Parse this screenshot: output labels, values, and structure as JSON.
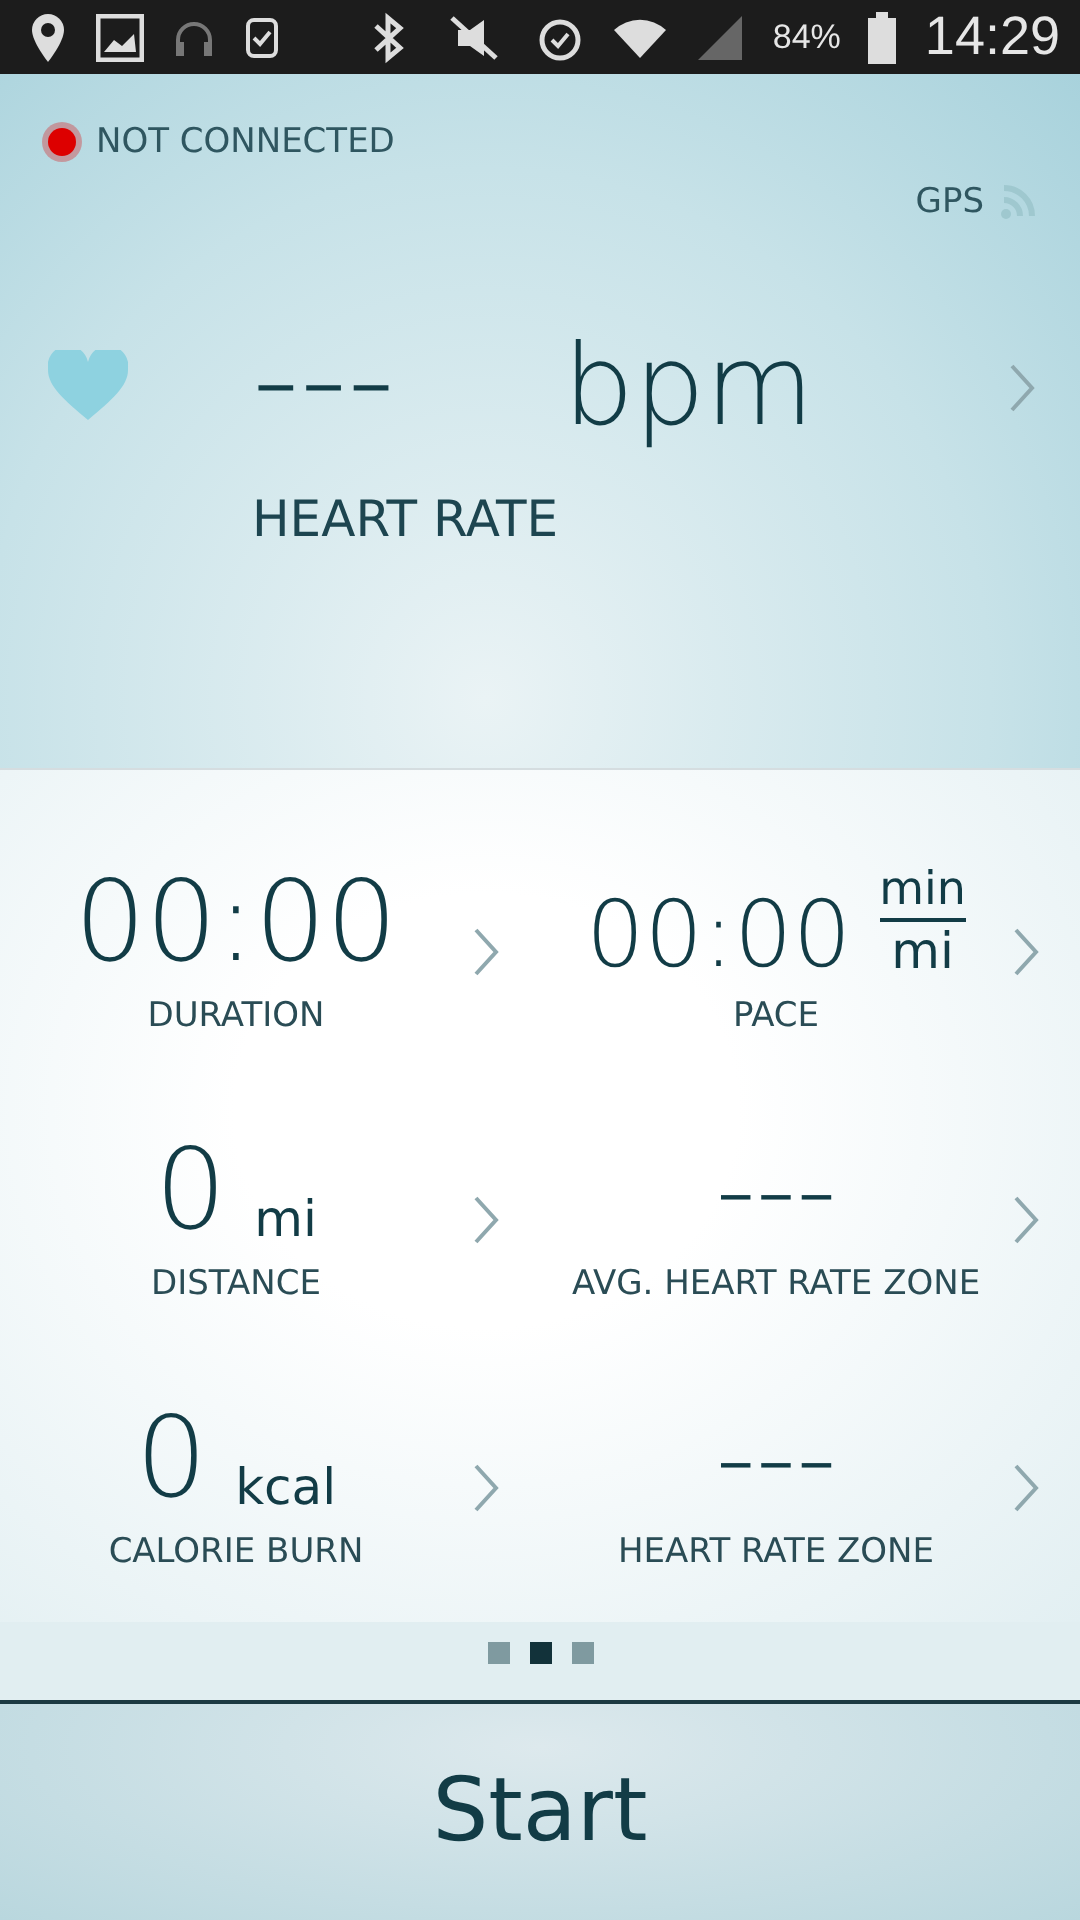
{
  "status_bar": {
    "battery": "84%",
    "time": "14:29"
  },
  "connection": {
    "label": "NOT CONNECTED",
    "connected": false
  },
  "gps": {
    "label": "GPS"
  },
  "heart_rate": {
    "value": "---",
    "unit": "bpm",
    "label": "HEART RATE"
  },
  "metrics": [
    {
      "kind": "value",
      "value": "00:00",
      "label": "DURATION"
    },
    {
      "kind": "fraction",
      "value": "00:00",
      "unit_top": "min",
      "unit_bottom": "mi",
      "label": "PACE"
    },
    {
      "kind": "unit",
      "value": "0",
      "unit": "mi",
      "label": "DISTANCE"
    },
    {
      "kind": "value",
      "value": "---",
      "label": "AVG. HEART RATE ZONE"
    },
    {
      "kind": "unit",
      "value": "0",
      "unit": "kcal",
      "label": "CALORIE BURN"
    },
    {
      "kind": "value",
      "value": "---",
      "label": "HEART RATE ZONE"
    }
  ],
  "pages": [
    {
      "selected": false
    },
    {
      "selected": true
    },
    {
      "selected": false
    }
  ],
  "start_button": "Start"
}
